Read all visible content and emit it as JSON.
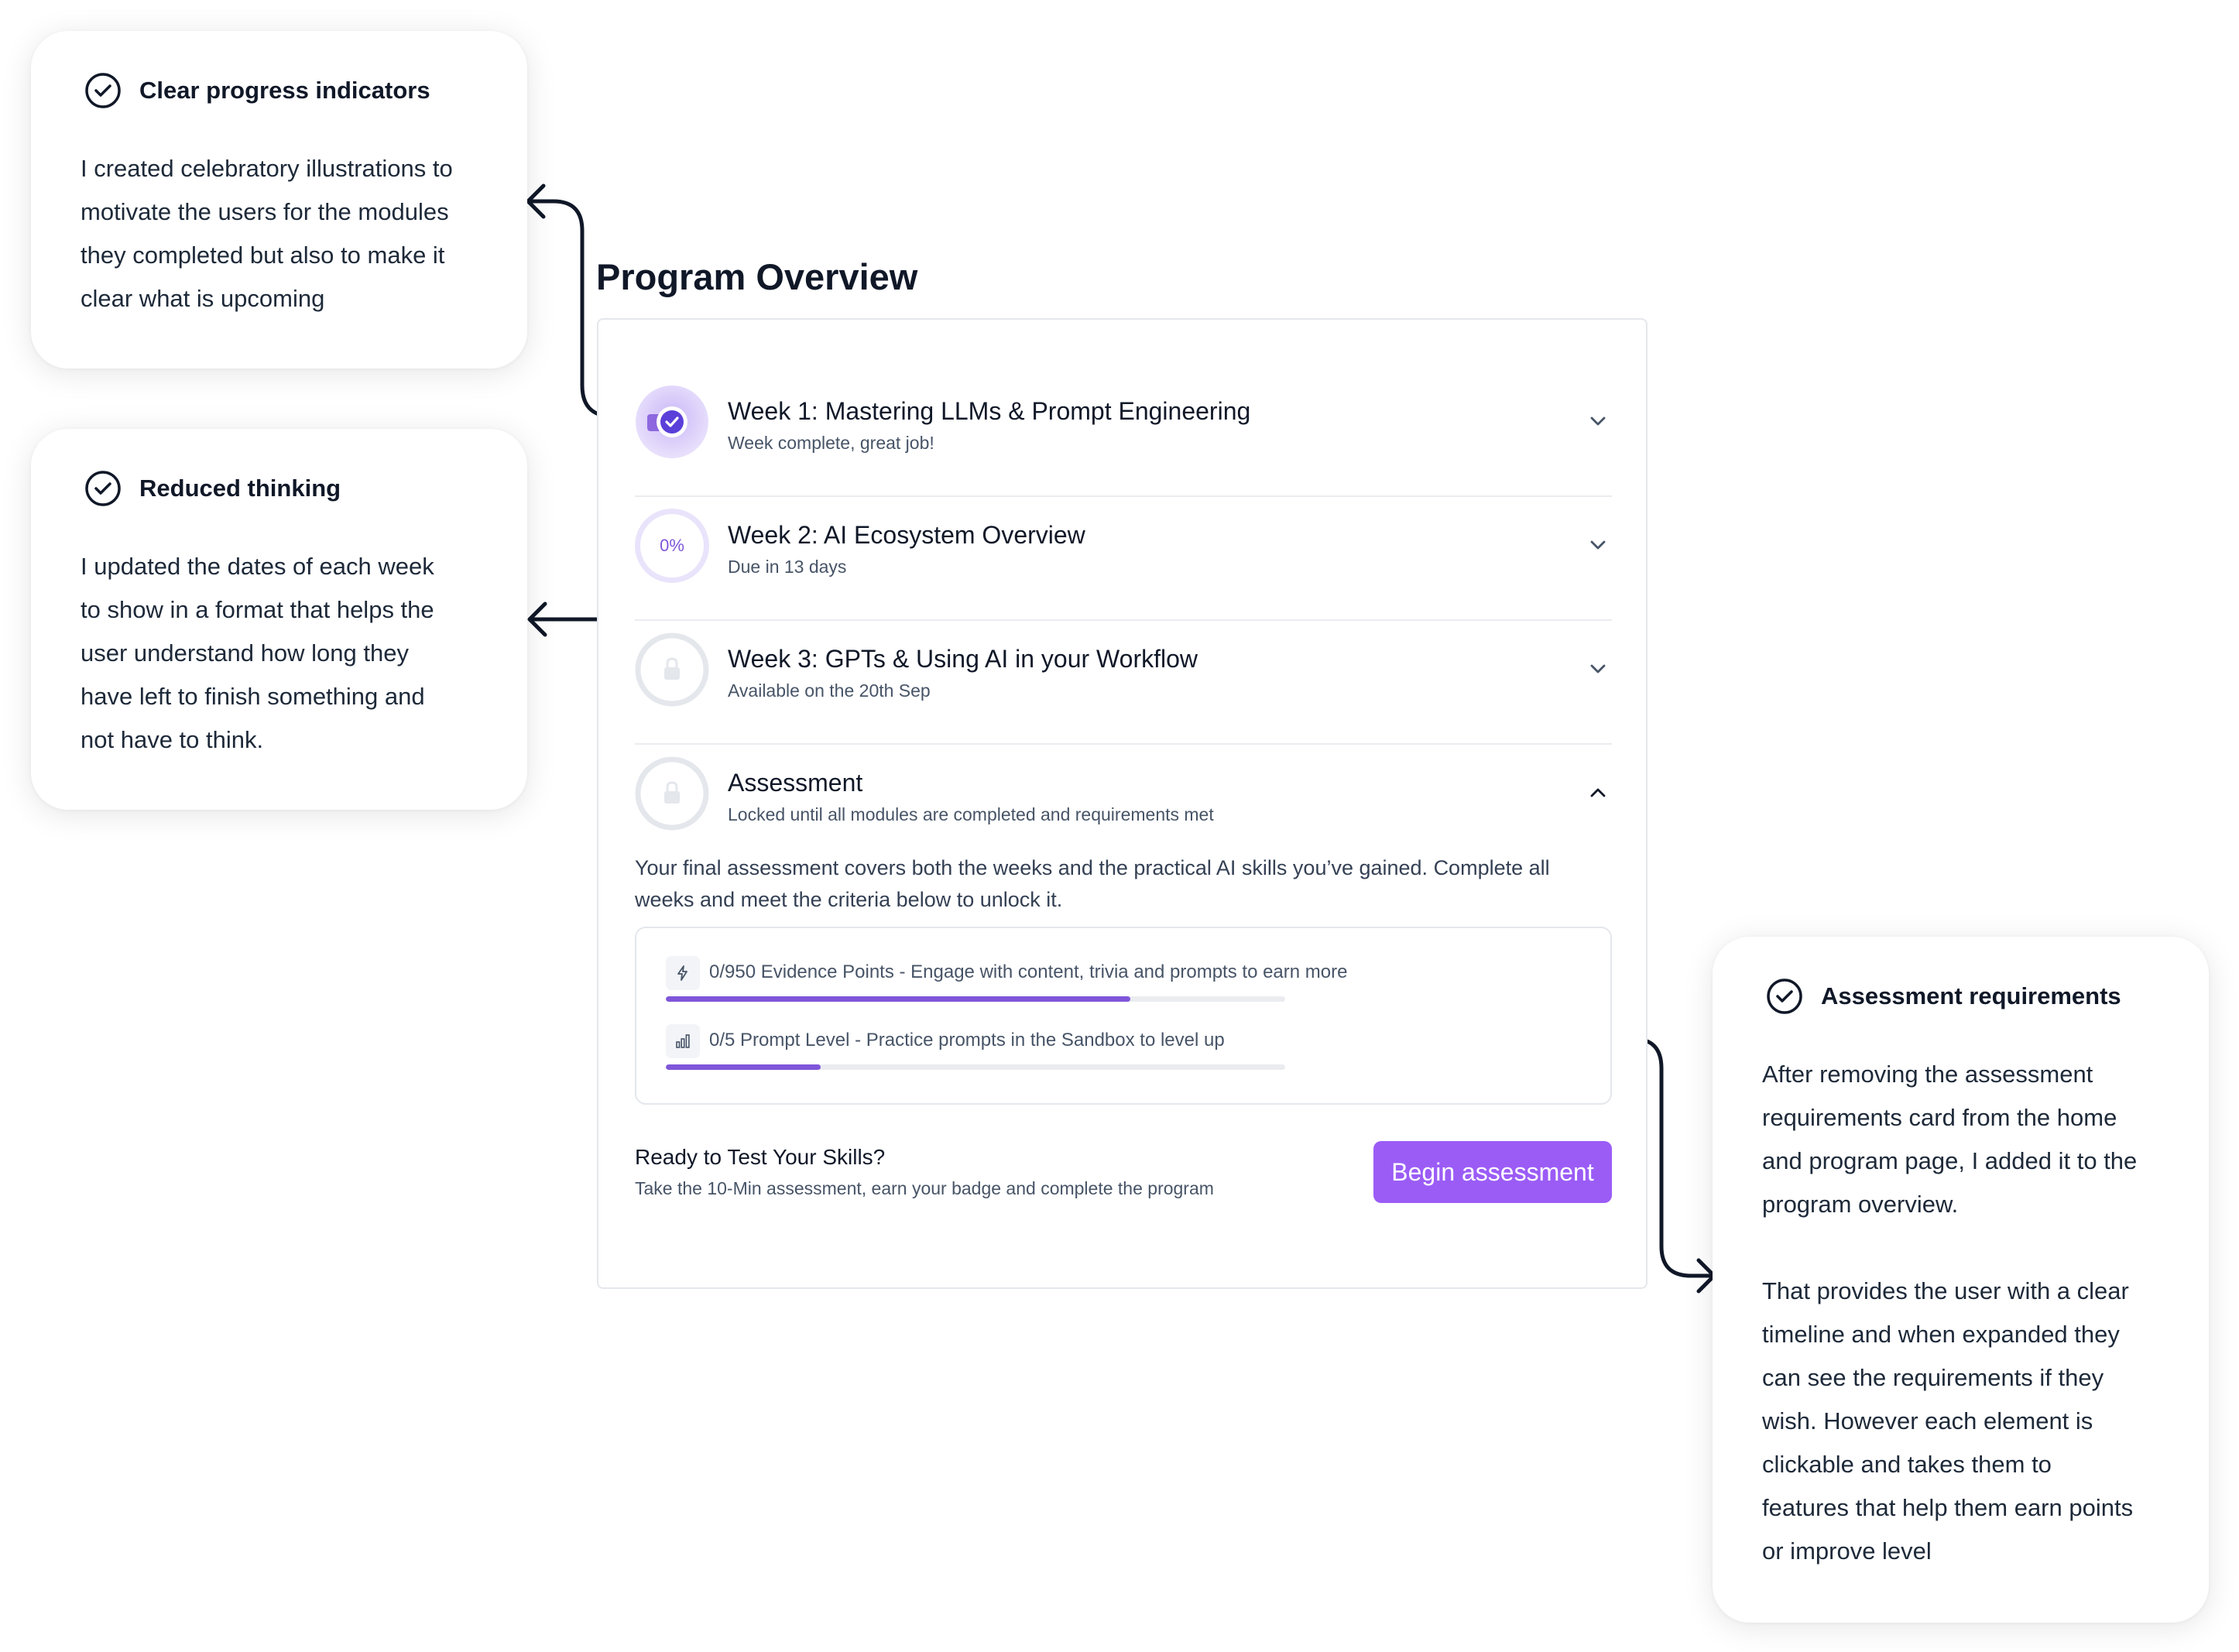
{
  "notes": {
    "progress": {
      "title": "Clear progress indicators",
      "lines": [
        "I created celebratory illustrations to",
        "motivate the users for the modules",
        "they completed but also to make it",
        "clear what is upcoming"
      ],
      "icon": "check-circle-icon"
    },
    "thinking": {
      "title": "Reduced thinking",
      "lines": [
        "I updated the dates of each week",
        "to show in a format that helps the",
        "user understand how long they",
        "have left to finish something and",
        "not have to think."
      ],
      "icon": "check-circle-icon"
    },
    "requirements": {
      "title": "Assessment requirements",
      "lines": [
        "After removing the assessment",
        "requirements card from the home",
        "and program page, I added it to the",
        "program overview.",
        "",
        "That provides the user with a clear",
        "timeline and when expanded they",
        "can see the requirements if they",
        "wish. However each element is",
        "clickable and takes them to",
        "features that help them earn points",
        "or improve level"
      ],
      "icon": "check-circle-icon"
    }
  },
  "overview": {
    "title": "Program Overview",
    "weeks": [
      {
        "title": "Week 1: Mastering LLMs & Prompt Engineering",
        "subtitle": "Week complete, great job!",
        "status": "complete",
        "icon": "completed-badge-icon"
      },
      {
        "title": "Week 2: AI Ecosystem Overview",
        "subtitle": "Due in 13 days",
        "status": "in-progress",
        "progress": "0%",
        "icon": "progress-ring-icon"
      },
      {
        "title": "Week 3: GPTs & Using AI in your Workflow",
        "subtitle": "Available on the 20th Sep",
        "status": "locked",
        "icon": "lock-icon"
      },
      {
        "title": "Assessment",
        "subtitle": "Locked until all modules are completed and requirements met",
        "status": "locked",
        "icon": "lock-icon"
      }
    ],
    "assessment": {
      "description": "Your final assessment covers both the weeks and the practical AI skills you’ve gained. Complete all weeks and meet the criteria below to unlock it.",
      "requirements": [
        {
          "text": "0/950 Evidence Points - Engage with content, trivia and prompts to earn more",
          "icon": "lightning-icon",
          "fill": 0.75
        },
        {
          "text": "0/5 Prompt Level - Practice prompts in the Sandbox to level up",
          "icon": "bar-chart-icon",
          "fill": 0.25
        }
      ],
      "ready_title": "Ready to Test Your Skills?",
      "ready_sub": "Take the 10-Min assessment, earn your badge and complete the program",
      "button": "Begin assessment"
    }
  },
  "colors": {
    "accent": "#9b5cf6",
    "progress": "#7f56d9",
    "ring": "#e9e3fb",
    "lock_ring": "#e4e7ec"
  }
}
